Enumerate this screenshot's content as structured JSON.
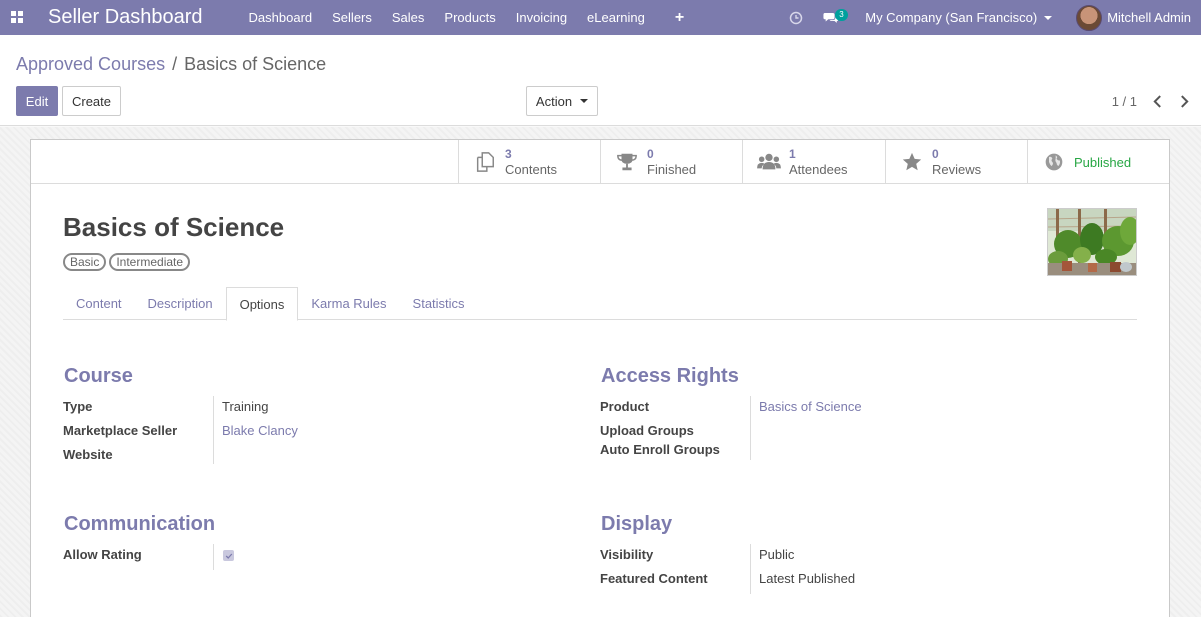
{
  "navbar": {
    "brand": "Seller Dashboard",
    "menu": [
      "Dashboard",
      "Sellers",
      "Sales",
      "Products",
      "Invoicing",
      "eLearning"
    ],
    "plus": "+",
    "chat_count": "3",
    "company": "My Company (San Francisco)",
    "user": "Mitchell Admin"
  },
  "breadcrumb": {
    "parent": "Approved Courses",
    "separator": "/",
    "current": "Basics of Science"
  },
  "buttons": {
    "edit": "Edit",
    "create": "Create",
    "action": "Action"
  },
  "pager": {
    "value": "1 / 1"
  },
  "stats": [
    {
      "value": "3",
      "label": "Contents",
      "icon": "copy-icon"
    },
    {
      "value": "0",
      "label": "Finished",
      "icon": "trophy-icon"
    },
    {
      "value": "1",
      "label": "Attendees",
      "icon": "users-icon"
    },
    {
      "value": "0",
      "label": "Reviews",
      "icon": "star-icon"
    }
  ],
  "published": {
    "label": "Published",
    "icon": "globe-icon",
    "color": "#28a745"
  },
  "record": {
    "title": "Basics of Science",
    "tags": [
      "Basic",
      "Intermediate"
    ]
  },
  "tabs": [
    "Content",
    "Description",
    "Options",
    "Karma Rules",
    "Statistics"
  ],
  "active_tab": "Options",
  "course_group": {
    "title": "Course",
    "type_label": "Type",
    "type_value": "Training",
    "seller_label": "Marketplace Seller",
    "seller_value": "Blake Clancy",
    "website_label": "Website",
    "website_value": ""
  },
  "access_group": {
    "title": "Access Rights",
    "product_label": "Product",
    "product_value": "Basics of Science",
    "upload_label": "Upload Groups",
    "enroll_label": "Auto Enroll Groups"
  },
  "communication_group": {
    "title": "Communication",
    "rating_label": "Allow Rating",
    "rating_checked": true
  },
  "display_group": {
    "title": "Display",
    "visibility_label": "Visibility",
    "visibility_value": "Public",
    "featured_label": "Featured Content",
    "featured_value": "Latest Published"
  },
  "colors": {
    "brand": "#7c7bad",
    "success": "#28a745",
    "badge": "#00a09d"
  }
}
